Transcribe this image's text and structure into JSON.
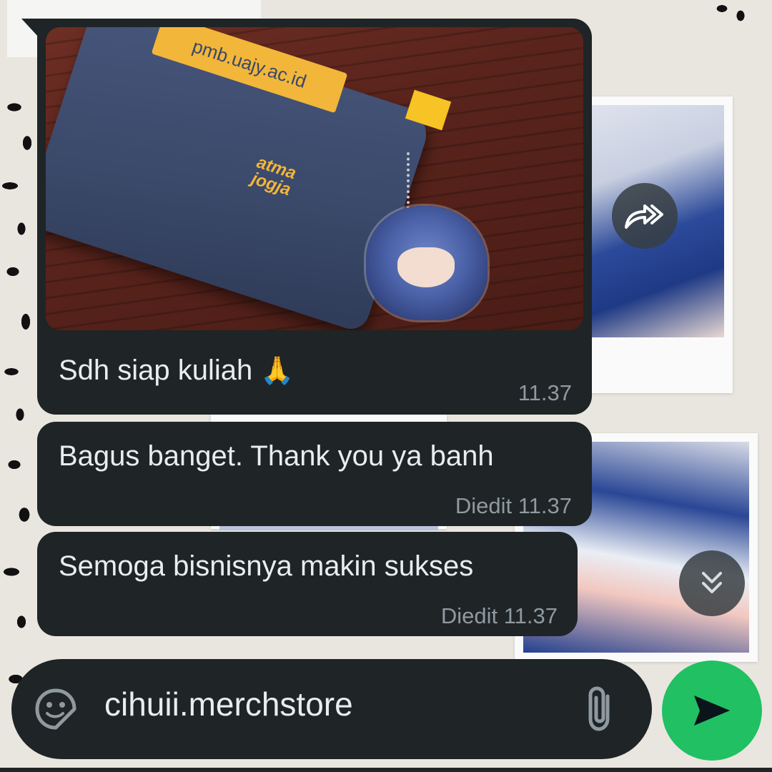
{
  "colors": {
    "bubble_bg": "#1f2426",
    "text_primary": "#e9edef",
    "text_meta": "#8f9aa0",
    "send_green": "#21c063",
    "wallpaper": "#e9e6df"
  },
  "messages": [
    {
      "type": "image",
      "image": {
        "pouch_label": "pmb.uajy.ac.id",
        "pouch_logo": "atma jogja"
      },
      "caption": "Sdh siap kuliah",
      "caption_emoji": "🙏",
      "time": "11.37"
    },
    {
      "type": "text",
      "text": "Bagus banget. Thank you ya banh",
      "edited_label": "Diedit",
      "time": "11.37"
    },
    {
      "type": "text",
      "text": "Semoga bisnisnya makin sukses",
      "edited_label": "Diedit",
      "time": "11.37"
    }
  ],
  "overlay_buttons": {
    "forward_icon": "forward-icon",
    "scroll_down_icon": "double-chevron-down-icon"
  },
  "composer": {
    "value": "cihuii.merchstore",
    "sticker_icon": "sticker-icon",
    "attach_icon": "paperclip-icon",
    "send_icon": "send-icon"
  }
}
